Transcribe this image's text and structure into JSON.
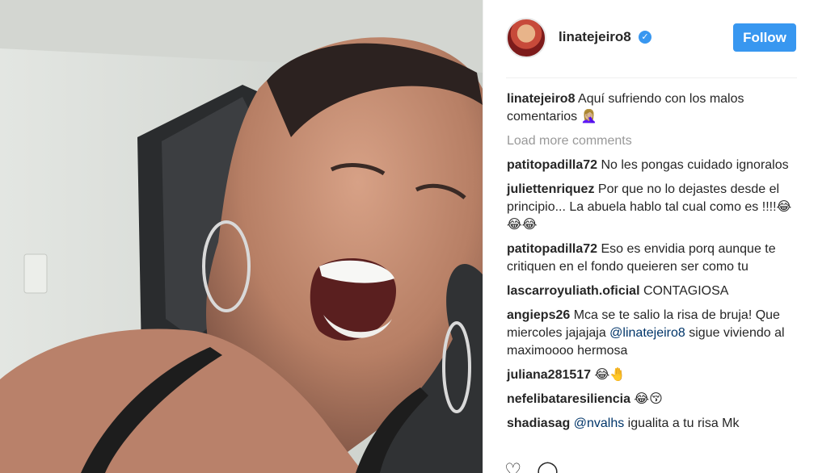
{
  "post": {
    "username": "linatejeiro8",
    "verified_icon": "verified-badge-icon",
    "follow_label": "Follow",
    "accent_color": "#3897f0"
  },
  "caption": {
    "user": "linatejeiro8",
    "text": " Aquí sufriendo con los malos comentarios 🤦🏼‍♀️"
  },
  "load_more": "Load more comments",
  "comments": [
    {
      "user": "patitopadilla72",
      "text": " No les pongas cuidado ignoralos"
    },
    {
      "user": "juliettenriquez",
      "text": " Por que no lo dejastes desde el principio... La abuela hablo tal cual como es !!!!😂😂😂"
    },
    {
      "user": "patitopadilla72",
      "text": " Eso es envidia porq aunque te critiquen en el fondo queieren ser como tu"
    },
    {
      "user": "lascarroyuliath.oficial",
      "text": " CONTAGIOSA"
    },
    {
      "user": "angieps26",
      "pre": " Mca se te salio la risa de bruja! Que miercoles jajajaja ",
      "mention": "@linatejeiro8",
      "post": " sigue viviendo al maximoooo hermosa"
    },
    {
      "user": "juliana281517",
      "text": " 😂🤚"
    },
    {
      "user": "nefelibataresiliencia",
      "text": " 😂😚"
    },
    {
      "user": "shadiasag",
      "pre": " ",
      "mention": "@nvalhs",
      "post": " igualita a tu risa Mk"
    }
  ],
  "actions": {
    "like_icon": "heart-icon",
    "comment_icon": "comment-icon"
  }
}
